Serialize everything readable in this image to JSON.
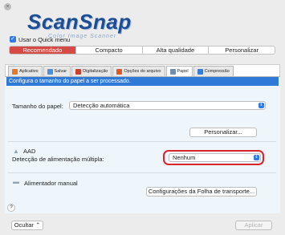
{
  "window": {
    "close": "×"
  },
  "logo": {
    "main": "ScanSnap",
    "sub": "Color Image Scanner"
  },
  "quick_menu": {
    "label": "Usar o Quick menu",
    "checked": true,
    "check": "✓"
  },
  "profiles": {
    "items": [
      "Recomendado",
      "Compacto",
      "Alta qualidade",
      "Personalizar"
    ],
    "active": "Recomendado"
  },
  "tabs": [
    {
      "label": "Aplicativo",
      "icon": "app-icon",
      "color": "#e27a2b"
    },
    {
      "label": "Salvar",
      "icon": "folder-icon",
      "color": "#4c8fd6"
    },
    {
      "label": "Digitalização",
      "icon": "scan-icon",
      "color": "#c8402d"
    },
    {
      "label": "Opções do arquivo",
      "icon": "file-icon",
      "color": "#d95b2a"
    },
    {
      "label": "Papel",
      "icon": "paper-icon",
      "color": "#6f8fb0"
    },
    {
      "label": "Compressão",
      "icon": "compression-icon",
      "color": "#3a7bd5"
    }
  ],
  "active_tab": "Papel",
  "paper": {
    "header": "Configura o tamanho do papel a ser processado.",
    "size_label": "Tamanho do papel:",
    "size_value": "Detecção automática",
    "customize_button": "Personalizar...",
    "aad_label": "AAD",
    "multifeed_label": "Detecção de alimentação múltipla:",
    "multifeed_value": "Nenhum",
    "manual_feeder_label": "Alimentador manual",
    "carrier_button": "Configurações da Folha de transporte..."
  },
  "footer": {
    "help": "?",
    "hide_button": "Ocultar",
    "hide_chevron": "⌃",
    "apply_button": "Aplicar"
  },
  "colors": {
    "accent": "#2f7ad6",
    "active_profile": "#d64a45",
    "highlight_box": "#d9242a"
  }
}
